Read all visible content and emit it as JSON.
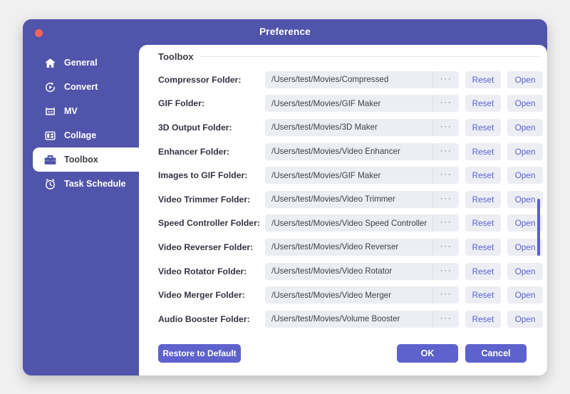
{
  "window": {
    "title": "Preference",
    "close_button": "close-dot",
    "accent_color": "#5154ab",
    "button_color": "#5e62cd",
    "link_color": "#5b5fd0",
    "field_bg": "#edeef4",
    "close_dot_color": "#f9655b"
  },
  "sidebar": {
    "items": [
      {
        "label": "General",
        "icon": "home-icon",
        "selected": false
      },
      {
        "label": "Convert",
        "icon": "convert-icon",
        "selected": false
      },
      {
        "label": "MV",
        "icon": "mv-icon",
        "selected": false
      },
      {
        "label": "Collage",
        "icon": "collage-icon",
        "selected": false
      },
      {
        "label": "Toolbox",
        "icon": "toolbox-icon",
        "selected": true
      },
      {
        "label": "Task Schedule",
        "icon": "clock-icon",
        "selected": false
      }
    ]
  },
  "panel": {
    "title": "Toolbox",
    "browse_label": "···",
    "reset_label": "Reset",
    "open_label": "Open",
    "rows": [
      {
        "label": "Compressor Folder:",
        "path": "/Users/test/Movies/Compressed"
      },
      {
        "label": "GIF Folder:",
        "path": "/Users/test/Movies/GIF Maker"
      },
      {
        "label": "3D Output Folder:",
        "path": "/Users/test/Movies/3D Maker"
      },
      {
        "label": "Enhancer Folder:",
        "path": "/Users/test/Movies/Video Enhancer"
      },
      {
        "label": "Images to GIF Folder:",
        "path": "/Users/test/Movies/GIF Maker"
      },
      {
        "label": "Video Trimmer Folder:",
        "path": "/Users/test/Movies/Video Trimmer"
      },
      {
        "label": "Speed Controller Folder:",
        "path": "/Users/test/Movies/Video Speed Controller"
      },
      {
        "label": "Video Reverser Folder:",
        "path": "/Users/test/Movies/Video Reverser"
      },
      {
        "label": "Video Rotator Folder:",
        "path": "/Users/test/Movies/Video Rotator"
      },
      {
        "label": "Video Merger Folder:",
        "path": "/Users/test/Movies/Video Merger"
      },
      {
        "label": "Audio Booster Folder:",
        "path": "/Users/test/Movies/Volume Booster"
      }
    ]
  },
  "footer": {
    "restore_label": "Restore to Default",
    "ok_label": "OK",
    "cancel_label": "Cancel"
  }
}
